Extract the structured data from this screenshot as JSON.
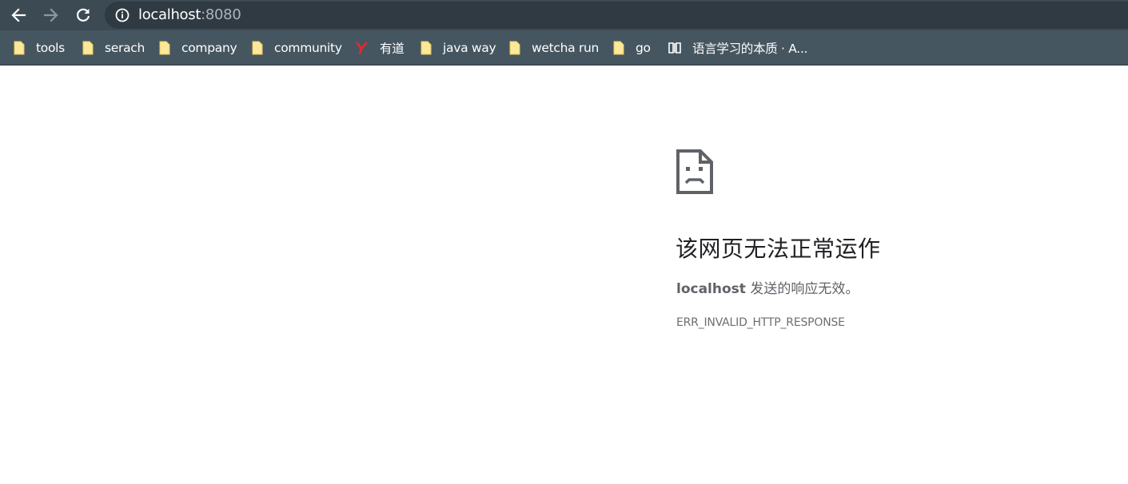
{
  "browser": {
    "address_bar": {
      "host": "localhost",
      "port": ":8080"
    },
    "nav": {
      "back_icon": "arrow-left-icon",
      "forward_icon": "arrow-right-icon",
      "reload_icon": "reload-icon",
      "site_info_icon": "info-icon"
    },
    "bookmarks": [
      {
        "label": "tools",
        "icon": "folder-icon"
      },
      {
        "label": "serach",
        "icon": "folder-icon"
      },
      {
        "label": "company",
        "icon": "folder-icon"
      },
      {
        "label": "community",
        "icon": "folder-icon"
      },
      {
        "label": "有道",
        "icon": "youdao-icon"
      },
      {
        "label": "java way",
        "icon": "folder-icon"
      },
      {
        "label": "wetcha run",
        "icon": "folder-icon"
      },
      {
        "label": "go",
        "icon": "folder-icon"
      },
      {
        "label": "语言学习的本质 · A...",
        "icon": "book-icon"
      }
    ]
  },
  "error_page": {
    "icon": "sad-page-icon",
    "title": "该网页无法正常运作",
    "host": "localhost",
    "message": " 发送的响应无效。",
    "code": "ERR_INVALID_HTTP_RESPONSE"
  },
  "colors": {
    "toolbar": "#3c4a54",
    "omnibox": "#2f3a42",
    "bookmarks_bar": "#465660",
    "folder": "#fbe89a"
  }
}
